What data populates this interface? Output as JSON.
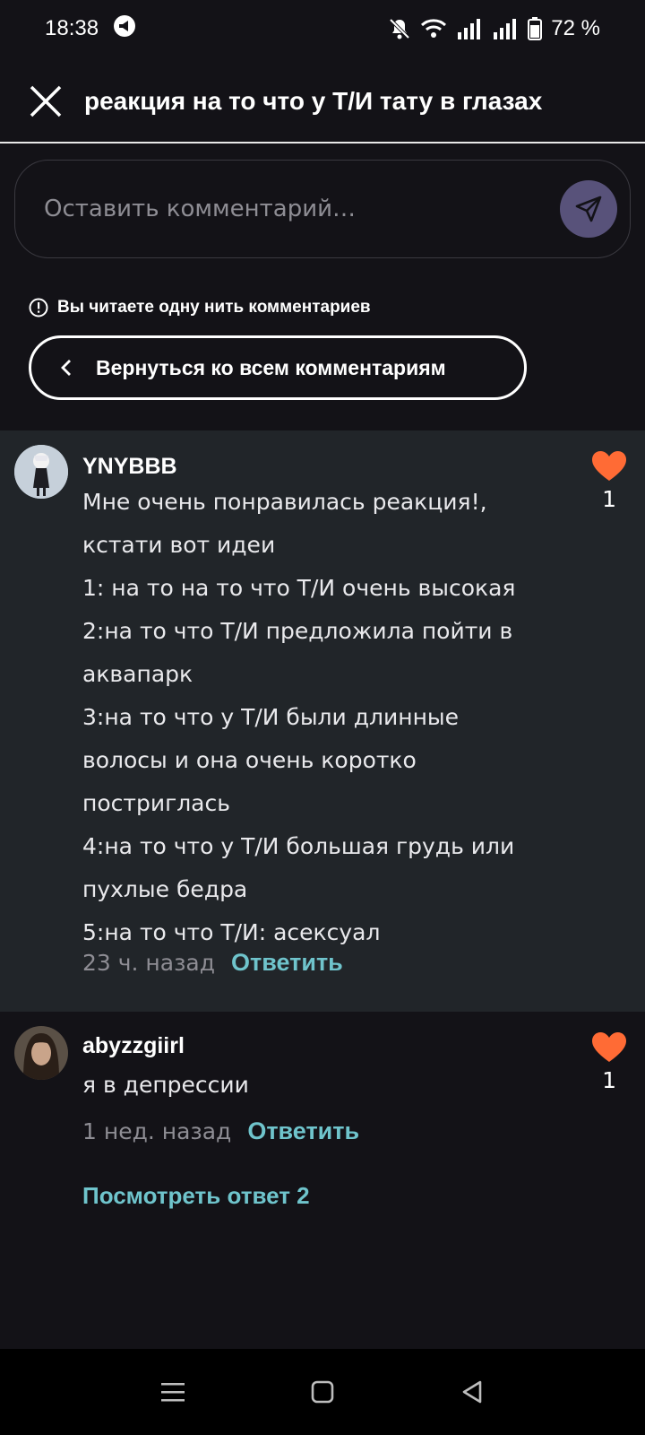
{
  "status": {
    "time": "18:38",
    "battery": "72 %",
    "icons": [
      "notification-app-icon",
      "mute-icon",
      "wifi-icon",
      "signal-icon",
      "signal-icon",
      "battery-icon"
    ]
  },
  "header": {
    "title": "реакция на то что у Т/И тату в глазах",
    "close_icon": "close-icon"
  },
  "composer": {
    "placeholder": "Оставить комментарий…",
    "send_icon": "send-icon"
  },
  "thread": {
    "note": "Вы читаете одну нить комментариев",
    "back_label": "Вернуться ко всем комментариям"
  },
  "comments": [
    {
      "username": "YNYBBB",
      "lines": [
        "Мне очень понравилась реакция!,",
        "кстати вот идеи",
        "1: на то на то что Т/И очень высокая",
        "2:на то что Т/И предложила пойти в",
        "аквапарк",
        "3:на то что у Т/И были длинные",
        "волосы и она очень коротко",
        "постриглась",
        "4:на то что у Т/И большая грудь или",
        "пухлые бедра",
        "5:на то что Т/И: асексуал"
      ],
      "time": "23 ч. назад",
      "reply": "Ответить",
      "likes": "1"
    },
    {
      "username": "abyzzgiirl",
      "lines": [
        "я в депрессии"
      ],
      "time": "1 нед. назад",
      "reply": "Ответить",
      "likes": "1",
      "view_replies": "Посмотреть ответ 2"
    }
  ],
  "colors": {
    "background": "#131217",
    "highlight": "#212529",
    "accent_link": "#6fc4cc",
    "like": "#ff6b35",
    "send_button": "#58527a"
  }
}
